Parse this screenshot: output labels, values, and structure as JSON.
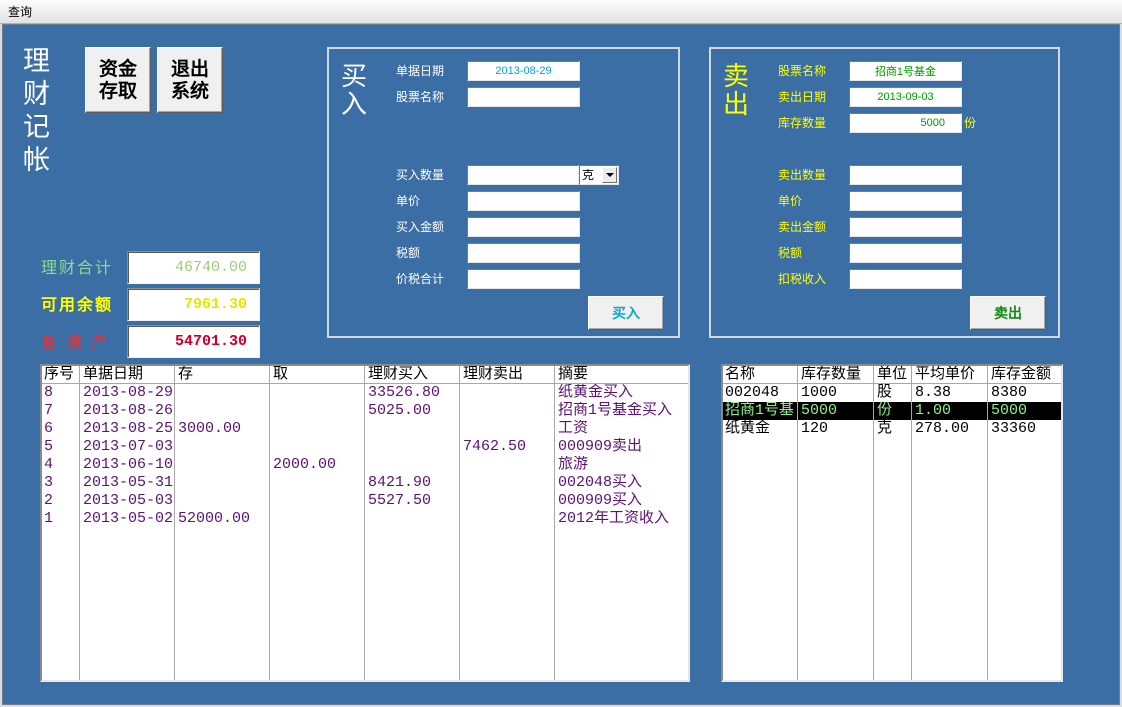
{
  "window": {
    "title": "查询"
  },
  "app": {
    "title": "理财记帐"
  },
  "nav": {
    "deposit_button": {
      "line1": "资金",
      "line2": "存取"
    },
    "exit_button": {
      "line1": "退出",
      "line2": "系统"
    }
  },
  "buy": {
    "heading": "买入",
    "date": {
      "label": "单据日期",
      "value": "2013-08-29"
    },
    "stock_name": {
      "label": "股票名称",
      "value": ""
    },
    "quantity": {
      "label": "买入数量",
      "value": "",
      "unit": "克"
    },
    "unit_price": {
      "label": "单价",
      "value": ""
    },
    "amount": {
      "label": "买入金额",
      "value": ""
    },
    "tax": {
      "label": "税额",
      "value": ""
    },
    "total_with_tax": {
      "label": "价税合计",
      "value": ""
    },
    "submit_label": "买入"
  },
  "sell": {
    "heading": "卖出",
    "stock_name": {
      "label": "股票名称",
      "value": "招商1号基金"
    },
    "date": {
      "label": "卖出日期",
      "value": "2013-09-03"
    },
    "stock_quantity": {
      "label": "库存数量",
      "value": "5000",
      "unit": "份"
    },
    "quantity": {
      "label": "卖出数量",
      "value": ""
    },
    "unit_price": {
      "label": "单价",
      "value": ""
    },
    "amount": {
      "label": "卖出金额",
      "value": ""
    },
    "tax": {
      "label": "税额",
      "value": ""
    },
    "net_income": {
      "label": "扣税收入",
      "value": ""
    },
    "submit_label": "卖出"
  },
  "summary": {
    "investment_total": {
      "label": "理财合计",
      "value": "46740.00"
    },
    "available_balance": {
      "label": "可用余额",
      "value": "7961.30"
    },
    "total_assets": {
      "label": "总 资 产",
      "value": "54701.30"
    }
  },
  "transactions": {
    "columns": [
      "序号",
      "单据日期",
      "存",
      "取",
      "理财买入",
      "理财卖出",
      "摘要"
    ],
    "rows": [
      [
        "8",
        "2013-08-29",
        "",
        "",
        "33526.80",
        "",
        "纸黄金买入"
      ],
      [
        "7",
        "2013-08-26",
        "",
        "",
        "5025.00",
        "",
        "招商1号基金买入"
      ],
      [
        "6",
        "2013-08-25",
        "3000.00",
        "",
        "",
        "",
        "工资"
      ],
      [
        "5",
        "2013-07-03",
        "",
        "",
        "",
        "7462.50",
        "000909卖出"
      ],
      [
        "4",
        "2013-06-10",
        "",
        "2000.00",
        "",
        "",
        "旅游"
      ],
      [
        "3",
        "2013-05-31",
        "",
        "",
        "8421.90",
        "",
        "002048买入"
      ],
      [
        "2",
        "2013-05-03",
        "",
        "",
        "5527.50",
        "",
        "000909买入"
      ],
      [
        "1",
        "2013-05-02",
        "52000.00",
        "",
        "",
        "",
        "2012年工资收入"
      ]
    ]
  },
  "holdings": {
    "columns": [
      "名称",
      "库存数量",
      "单位",
      "平均单价",
      "库存金额"
    ],
    "rows": [
      [
        "002048",
        "1000",
        "股",
        "8.38",
        "8380"
      ],
      [
        "招商1号基",
        "5000",
        "份",
        "1.00",
        "5000"
      ],
      [
        "纸黄金",
        "120",
        "克",
        "278.00",
        "33360"
      ]
    ],
    "selected_row": 1
  },
  "colors": {
    "background": "#3a6ea5",
    "buy_value": "#0a9ecf",
    "buy_button": "#10a8c8",
    "sell_value": "#009900",
    "sell_button": "#108a10",
    "sell_label": "#ffff00",
    "investment_total": "#8fd88f",
    "investment_value": "#9ccc78",
    "available_balance": "#ffff00",
    "available_value": "#e6e600",
    "total_assets": "#ff2a2a",
    "total_assets_value": "#c8002c",
    "transaction_text": "#5a1372",
    "selected_row_bg": "#000000",
    "selected_row_text": "#8fef8f"
  }
}
